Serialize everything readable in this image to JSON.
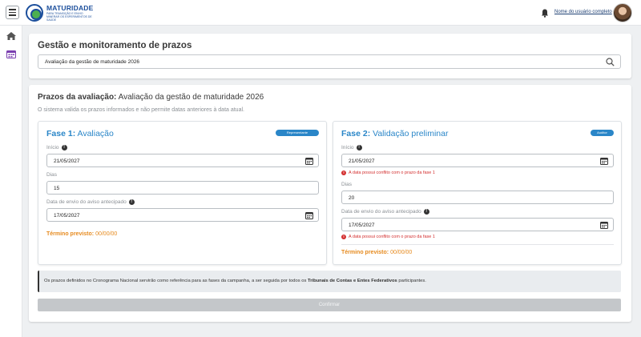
{
  "header": {
    "logo_title": "MATURIDADE",
    "logo_subtitle": "PARA TRANSIÇÃO E ENVIO MINERAR OS ESPERIMENTOS DE SAÚDE",
    "user_name": "Nome do usuário completo"
  },
  "search_card": {
    "title": "Gestão e monitoramento de prazos",
    "search_value": "Avaliação da gestão de maturidade 2026"
  },
  "deadlines": {
    "title_prefix": "Prazos da avaliação:",
    "title_value": " Avaliação da gestão de maturidade 2026",
    "description": "O sistema valida os prazos informados e não permite datas anteriores à data atual."
  },
  "phase1": {
    "title_prefix": "Fase 1:",
    "title_name": " Avaliação",
    "badge": "Representante",
    "start_label": "Início",
    "start_value": "21/05/2027",
    "days_label": "Dias",
    "days_value": "15",
    "notice_label": "Data de envio do aviso antecipado",
    "notice_value": "17/05/2027",
    "end_label": "Término previsto:",
    "end_value": " 00/00/00"
  },
  "phase2": {
    "title_prefix": "Fase 2:",
    "title_name": " Validação preliminar",
    "badge": "Auditor",
    "start_label": "Início",
    "start_value": "21/05/2027",
    "start_error": "A data  possui conflito com o prazo da fase 1",
    "days_label": "Dias",
    "days_value": "20",
    "notice_label": "Data de envio do aviso antecipado",
    "notice_value": "17/05/2027",
    "notice_error": "A data  possui conflito com o prazo da fase 1",
    "end_label": "Término previsto:",
    "end_value": " 00/00/00"
  },
  "footer_notice": {
    "text_before": "Os prazos definidos no Cronograma Nacional servirão como referência para as fases da campanha, a ser seguida por todos os ",
    "text_bold": "Tribunais de Contas e Entes Federativos",
    "text_after": " participantes."
  },
  "confirm_label": "Confirmar",
  "colors": {
    "accent": "#2a86c8",
    "warning": "#e68a1e",
    "error": "#d32f2f",
    "brand": "#1c4f9c"
  }
}
